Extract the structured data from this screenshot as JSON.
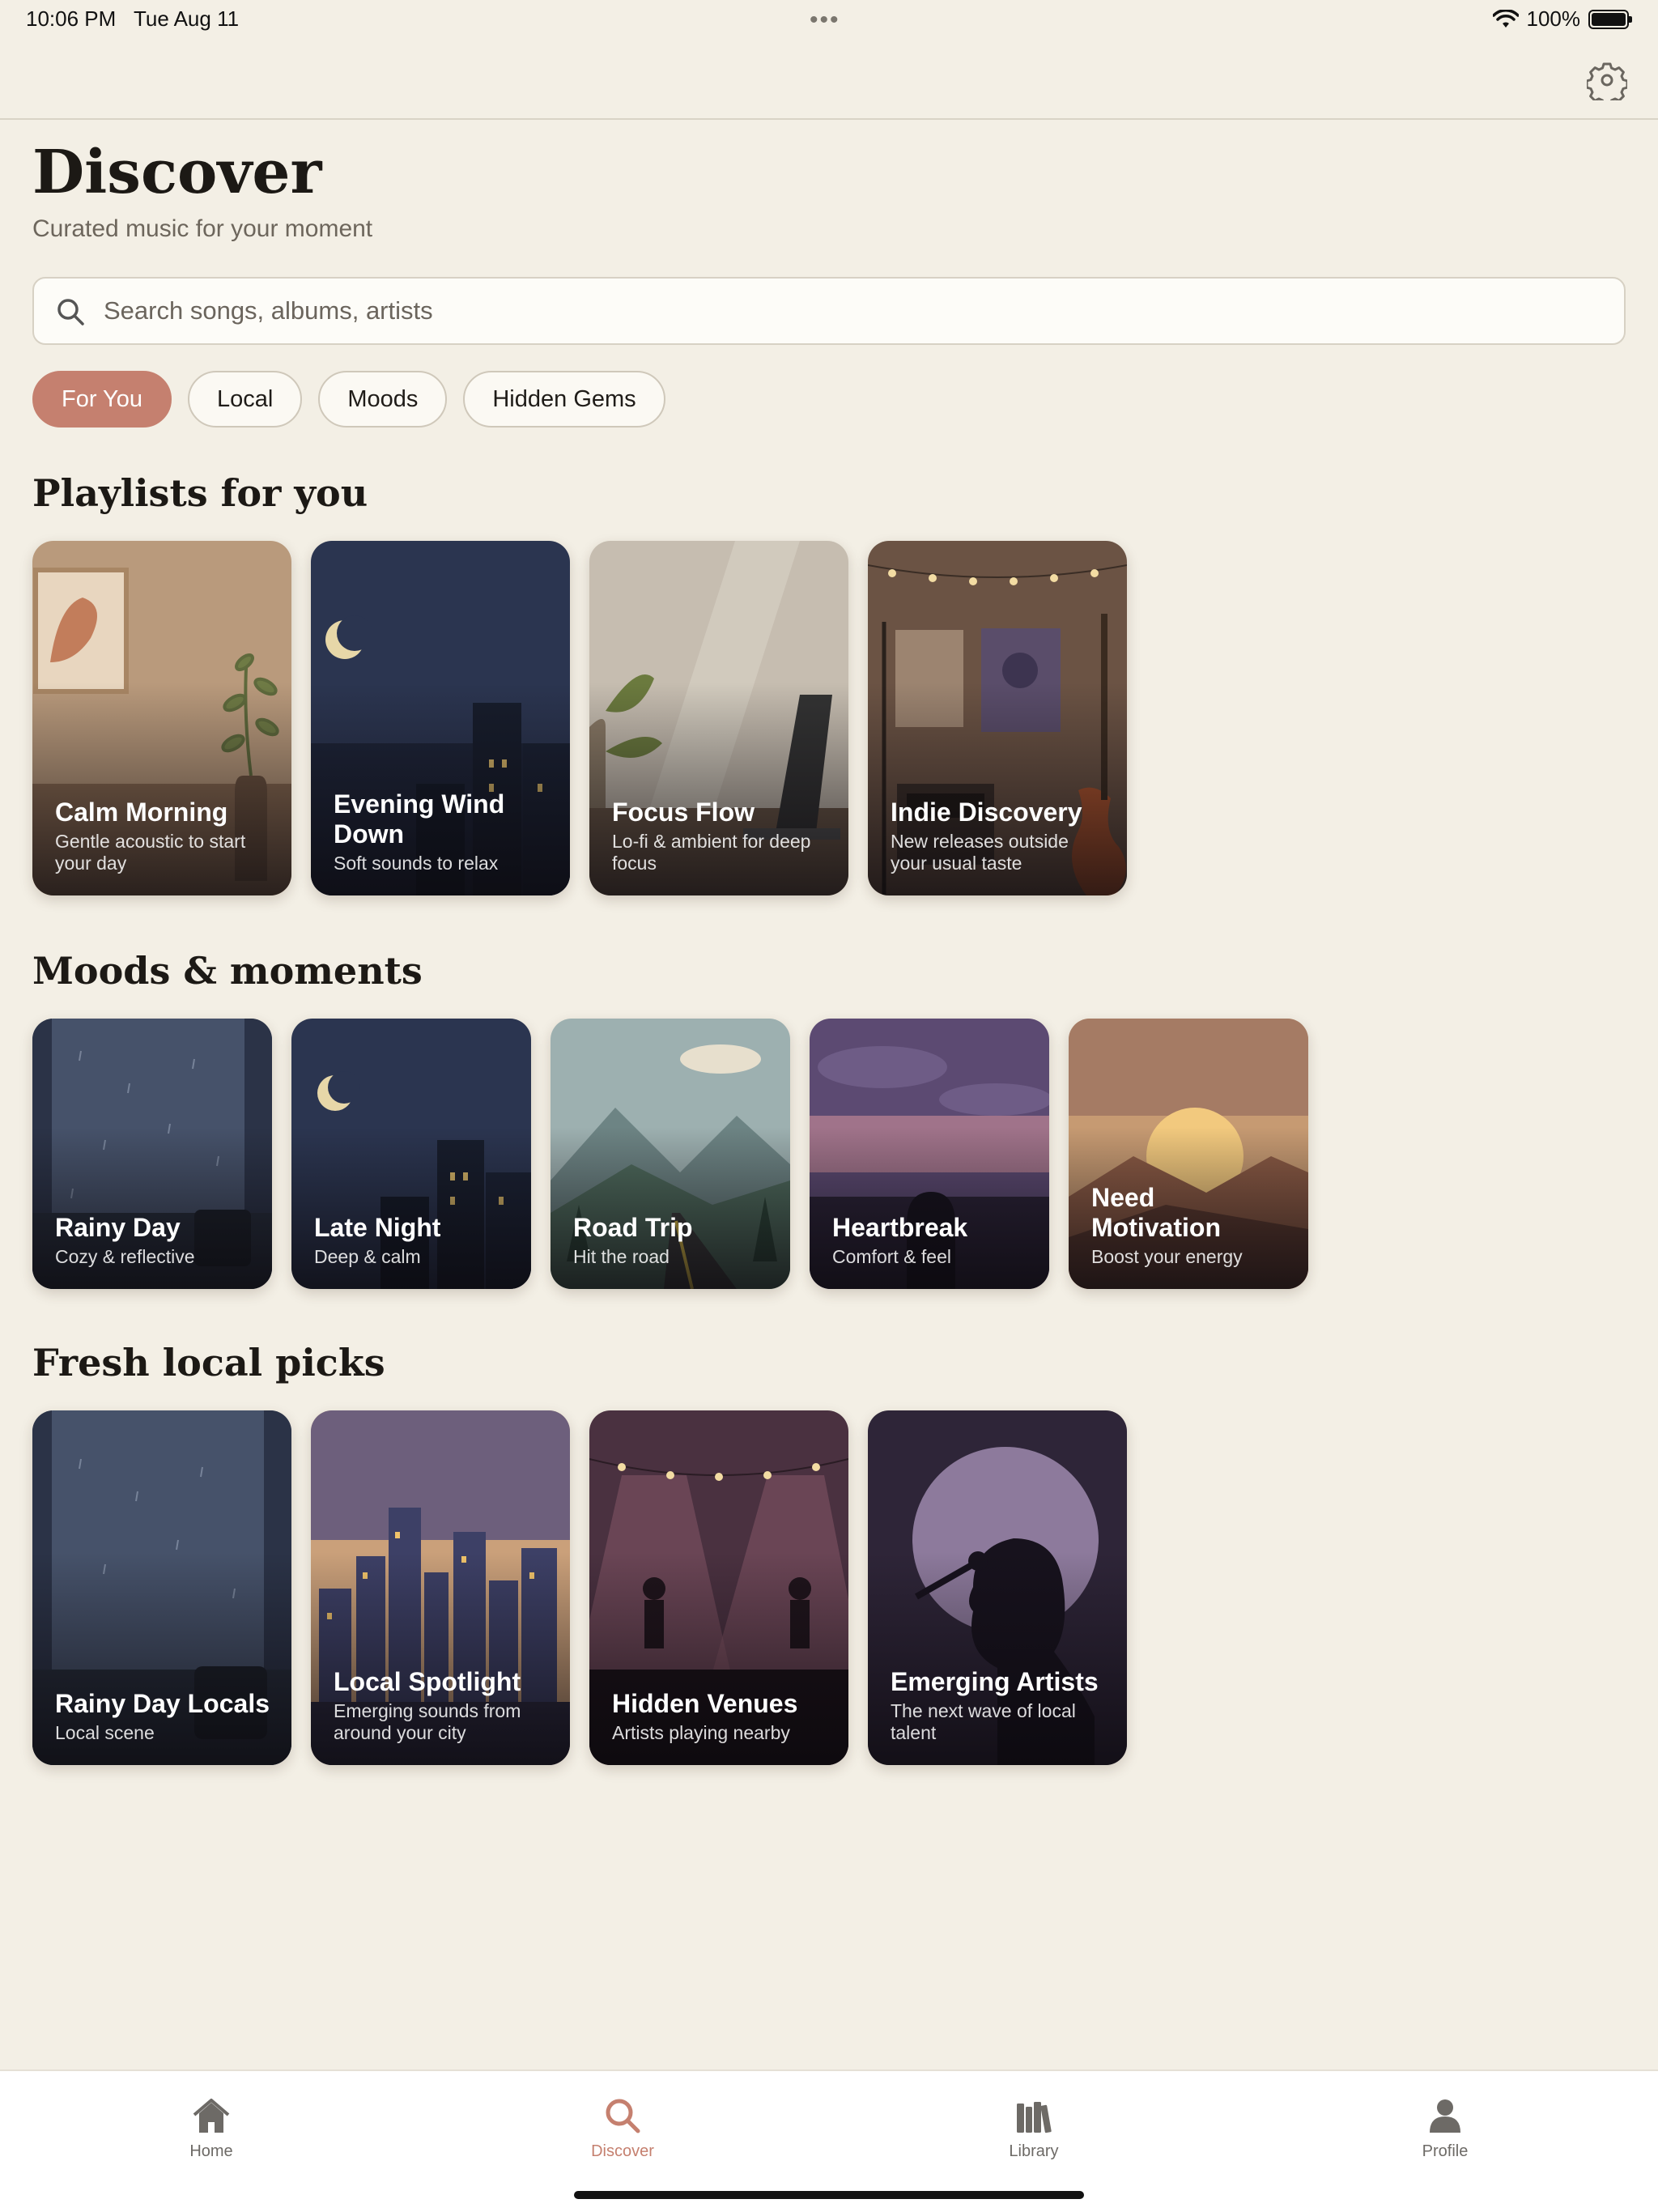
{
  "status_bar": {
    "time": "10:06 PM",
    "date": "Tue Aug 11",
    "battery": "100%",
    "battery_level": 1.0
  },
  "header": {
    "title": "Discover",
    "subtitle": "Curated music for your moment"
  },
  "search": {
    "placeholder": "Search songs, albums, artists"
  },
  "chips": [
    {
      "label": "For You",
      "active": true
    },
    {
      "label": "Local",
      "active": false
    },
    {
      "label": "Moods",
      "active": false
    },
    {
      "label": "Hidden Gems",
      "active": false
    }
  ],
  "sections": {
    "playlists": {
      "title": "Playlists for you",
      "cards": [
        {
          "title": "Calm Morning",
          "subtitle": "Gentle acoustic to start your day"
        },
        {
          "title": "Evening Wind Down",
          "subtitle": "Soft sounds to relax"
        },
        {
          "title": "Focus Flow",
          "subtitle": "Lo-fi & ambient for deep focus"
        },
        {
          "title": "Indie Discovery",
          "subtitle": "New releases outside your usual taste"
        }
      ]
    },
    "moods": {
      "title": "Moods & moments",
      "cards": [
        {
          "title": "Rainy Day",
          "subtitle": "Cozy & reflective"
        },
        {
          "title": "Late Night",
          "subtitle": "Deep & calm"
        },
        {
          "title": "Road Trip",
          "subtitle": "Hit the road"
        },
        {
          "title": "Heartbreak",
          "subtitle": "Comfort & feel"
        },
        {
          "title": "Need Motivation",
          "subtitle": "Boost your energy"
        }
      ]
    },
    "local": {
      "title": "Fresh local picks",
      "cards": [
        {
          "title": "Rainy Day Locals",
          "subtitle": "Local scene"
        },
        {
          "title": "Local Spotlight",
          "subtitle": "Emerging sounds from around your city"
        },
        {
          "title": "Hidden Venues",
          "subtitle": "Artists playing nearby"
        },
        {
          "title": "Emerging Artists",
          "subtitle": "The next wave of local talent"
        }
      ]
    }
  },
  "tabs": [
    {
      "label": "Home",
      "icon": "house-icon",
      "active": false
    },
    {
      "label": "Discover",
      "icon": "magnifier-icon",
      "active": true
    },
    {
      "label": "Library",
      "icon": "books-icon",
      "active": false
    },
    {
      "label": "Profile",
      "icon": "person-icon",
      "active": false
    }
  ],
  "colors": {
    "background": "#f3efe5",
    "accent": "#c5806f",
    "text": "#1e1b17"
  }
}
